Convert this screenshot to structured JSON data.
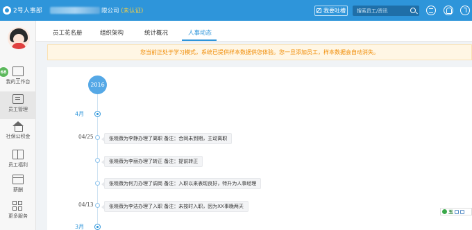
{
  "app": {
    "logo_text": "2号人事部",
    "company_suffix": "限公司",
    "unverified_label": "(未认证)"
  },
  "header": {
    "feedback_label": "我要吐槽",
    "search_placeholder": "搜索员工/资讯"
  },
  "sidebar": {
    "badge_count": "68",
    "items": [
      {
        "label": "我的工作台",
        "icon": "desktop-icon"
      },
      {
        "label": "员工管理",
        "icon": "staff-card-icon"
      },
      {
        "label": "社保公积金",
        "icon": "house-icon"
      },
      {
        "label": "员工福利",
        "icon": "gift-icon"
      },
      {
        "label": "薪酬",
        "icon": "calendar-icon"
      },
      {
        "label": "更多服务",
        "icon": "grid-icon"
      }
    ]
  },
  "tabs": [
    {
      "label": "员工花名册"
    },
    {
      "label": "组织架构"
    },
    {
      "label": "统计概况"
    },
    {
      "label": "人事动态"
    }
  ],
  "notice": "您当前正处于学习模式，系统已提供样本数据供您体验。您一旦添加员工，样本数据会自动消失。",
  "timeline": {
    "year": "2016",
    "months": [
      "4月",
      "3月"
    ],
    "dates": [
      "04/25",
      "04/13"
    ],
    "events": [
      "张晓薇为李静办理了离职    备注：合同未到期，主动离职",
      "张晓薇为李丽办理了转正    备注：提前转正",
      "张晓薇为何力办理了调岗    备注：入职以来表现良好，特升为人事经理",
      "张晓薇为李洁办理了入职    备注：未按时入职，因为XX事晚两天"
    ]
  },
  "ime": {
    "glyph": "五"
  }
}
